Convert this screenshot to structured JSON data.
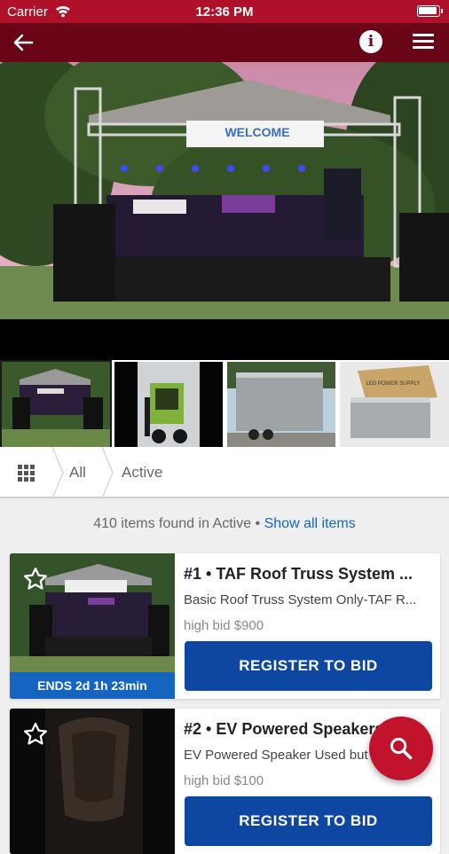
{
  "status_bar": {
    "carrier": "Carrier",
    "time": "12:36 PM"
  },
  "app_bar": {
    "back_icon": "arrow-left-icon",
    "info_icon": "info-icon",
    "menu_icon": "hamburger-menu-icon"
  },
  "colors": {
    "brand": "#b0112a",
    "app_bar": "#6a0518",
    "accent_blue": "#1565c0",
    "button_blue": "#0d47a1"
  },
  "filters": {
    "grid_icon": "grid-icon",
    "crumbs": [
      {
        "label": "All"
      },
      {
        "label": "Active"
      }
    ]
  },
  "results": {
    "count_text": "410 items found in Active",
    "separator": " • ",
    "show_all_label": "Show all items"
  },
  "items": [
    {
      "title": "#1 • TAF Roof Truss System ...",
      "description": "Basic Roof Truss System Only-TAF R...",
      "high_bid": "high bid $900",
      "ends": "ENDS 2d 1h 23min",
      "register_label": "REGISTER TO BID"
    },
    {
      "title": "#2 • EV Powered Speakers",
      "description": "EV Powered Speaker Used but",
      "high_bid": "high bid $100",
      "register_label": "REGISTER TO BID"
    }
  ],
  "fab": {
    "icon": "search-icon"
  }
}
